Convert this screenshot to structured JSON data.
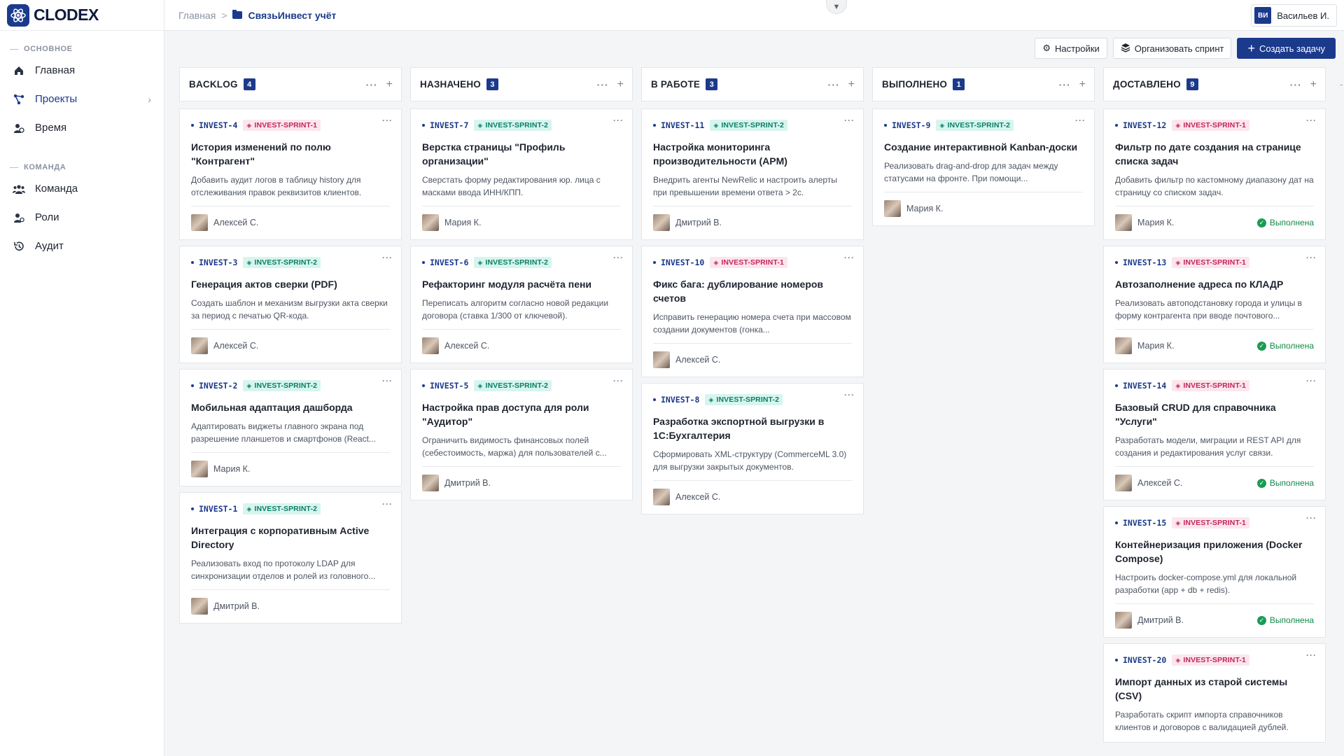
{
  "app": {
    "logo_text": "CLODEX"
  },
  "sidebar": {
    "sections": [
      {
        "label": "ОСНОВНОЕ",
        "items": [
          {
            "label": "Главная",
            "icon": "home-icon"
          },
          {
            "label": "Проекты",
            "icon": "projects-icon",
            "active": true,
            "has_chevron": true
          },
          {
            "label": "Время",
            "icon": "time-icon"
          }
        ]
      },
      {
        "label": "КОМАНДА",
        "items": [
          {
            "label": "Команда",
            "icon": "team-icon"
          },
          {
            "label": "Роли",
            "icon": "roles-icon"
          },
          {
            "label": "Аудит",
            "icon": "audit-icon"
          }
        ]
      }
    ]
  },
  "breadcrumb": {
    "home": "Главная",
    "separator": ">",
    "current": "СвязьИнвест учёт"
  },
  "user": {
    "initials": "ВИ",
    "name": "Васильев И."
  },
  "toolbar": {
    "settings_label": "Настройки",
    "sprint_label": "Организовать спринт",
    "create_label": "Создать задачу"
  },
  "colors": {
    "accent": "#1b3a8c",
    "sprint1": "#c2255c",
    "sprint2": "#0d7d65",
    "done": "#1c9b55"
  },
  "columns": [
    {
      "title": "BACKLOG",
      "count": "4",
      "cards": [
        {
          "id": "INVEST-4",
          "sprint": "INVEST-SPRINT-1",
          "sprint_kind": "s1",
          "title": "История изменений по полю \"Контрагент\"",
          "desc": "Добавить аудит логов в таблицу history для отслеживания правок реквизитов клиентов.",
          "assignee": "Алексей С.",
          "status": ""
        },
        {
          "id": "INVEST-3",
          "sprint": "INVEST-SPRINT-2",
          "sprint_kind": "s2",
          "title": "Генерация актов сверки (PDF)",
          "desc": "Создать шаблон и механизм выгрузки акта сверки за период с печатью QR-кода.",
          "assignee": "Алексей С.",
          "status": ""
        },
        {
          "id": "INVEST-2",
          "sprint": "INVEST-SPRINT-2",
          "sprint_kind": "s2",
          "title": "Мобильная адаптация дашборда",
          "desc": "Адаптировать виджеты главного экрана под разрешение планшетов и смартфонов (React...",
          "assignee": "Мария К.",
          "status": ""
        },
        {
          "id": "INVEST-1",
          "sprint": "INVEST-SPRINT-2",
          "sprint_kind": "s2",
          "title": "Интеграция с корпоративным Active Directory",
          "desc": "Реализовать вход по протоколу LDAP для синхронизации отделов и ролей из головного...",
          "assignee": "Дмитрий В.",
          "status": ""
        }
      ]
    },
    {
      "title": "НАЗНАЧЕНО",
      "count": "3",
      "cards": [
        {
          "id": "INVEST-7",
          "sprint": "INVEST-SPRINT-2",
          "sprint_kind": "s2",
          "title": "Верстка страницы \"Профиль организации\"",
          "desc": "Сверстать форму редактирования юр. лица с масками ввода ИНН/КПП.",
          "assignee": "Мария К.",
          "status": ""
        },
        {
          "id": "INVEST-6",
          "sprint": "INVEST-SPRINT-2",
          "sprint_kind": "s2",
          "title": "Рефакторинг модуля расчёта пени",
          "desc": "Переписать алгоритм согласно новой редакции договора (ставка 1/300 от ключевой).",
          "assignee": "Алексей С.",
          "status": ""
        },
        {
          "id": "INVEST-5",
          "sprint": "INVEST-SPRINT-2",
          "sprint_kind": "s2",
          "title": "Настройка прав доступа для роли \"Аудитор\"",
          "desc": "Ограничить видимость финансовых полей (себестоимость, маржа) для пользователей с...",
          "assignee": "Дмитрий В.",
          "status": ""
        }
      ]
    },
    {
      "title": "В РАБОТЕ",
      "count": "3",
      "cards": [
        {
          "id": "INVEST-11",
          "sprint": "INVEST-SPRINT-2",
          "sprint_kind": "s2",
          "title": "Настройка мониторинга производительности (APM)",
          "desc": "Внедрить агенты NewRelic и настроить алерты при превышении времени ответа > 2с.",
          "assignee": "Дмитрий В.",
          "status": ""
        },
        {
          "id": "INVEST-10",
          "sprint": "INVEST-SPRINT-1",
          "sprint_kind": "s1",
          "title": "Фикс бага: дублирование номеров счетов",
          "desc": "Исправить генерацию номера счета при массовом создании документов (гонка...",
          "assignee": "Алексей С.",
          "status": ""
        },
        {
          "id": "INVEST-8",
          "sprint": "INVEST-SPRINT-2",
          "sprint_kind": "s2",
          "title": "Разработка экспортной выгрузки в 1С:Бухгалтерия",
          "desc": "Сформировать XML-структуру (CommerceML 3.0) для выгрузки закрытых документов.",
          "assignee": "Алексей С.",
          "status": ""
        }
      ]
    },
    {
      "title": "ВЫПОЛНЕНО",
      "count": "1",
      "cards": [
        {
          "id": "INVEST-9",
          "sprint": "INVEST-SPRINT-2",
          "sprint_kind": "s2",
          "title": "Создание интерактивной Kanban-доски",
          "desc": "Реализовать drag-and-drop для задач между статусами на фронте. При помощи...",
          "assignee": "Мария К.",
          "status": ""
        }
      ]
    },
    {
      "title": "ДОСТАВЛЕНО",
      "count": "9",
      "cards": [
        {
          "id": "INVEST-12",
          "sprint": "INVEST-SPRINT-1",
          "sprint_kind": "s1",
          "title": "Фильтр по дате создания на странице списка задач",
          "desc": "Добавить фильтр по кастомному диапазону дат на страницу со списком задач.",
          "assignee": "Мария К.",
          "status": "Выполнена"
        },
        {
          "id": "INVEST-13",
          "sprint": "INVEST-SPRINT-1",
          "sprint_kind": "s1",
          "title": "Автозаполнение адреса по КЛАДР",
          "desc": "Реализовать автоподстановку города и улицы в форму контрагента при вводе почтового...",
          "assignee": "Мария К.",
          "status": "Выполнена"
        },
        {
          "id": "INVEST-14",
          "sprint": "INVEST-SPRINT-1",
          "sprint_kind": "s1",
          "title": "Базовый CRUD для справочника \"Услуги\"",
          "desc": "Разработать модели, миграции и REST API для создания и редактирования услуг связи.",
          "assignee": "Алексей С.",
          "status": "Выполнена"
        },
        {
          "id": "INVEST-15",
          "sprint": "INVEST-SPRINT-1",
          "sprint_kind": "s1",
          "title": "Контейнеризация приложения (Docker Compose)",
          "desc": "Настроить docker-compose.yml для локальной разработки (app + db + redis).",
          "assignee": "Дмитрий В.",
          "status": "Выполнена"
        },
        {
          "id": "INVEST-20",
          "sprint": "INVEST-SPRINT-1",
          "sprint_kind": "s1",
          "title": "Импорт данных из старой системы (CSV)",
          "desc": "Разработать скрипт импорта справочников клиентов и договоров с валидацией дублей.",
          "assignee": "",
          "status": ""
        }
      ]
    }
  ]
}
